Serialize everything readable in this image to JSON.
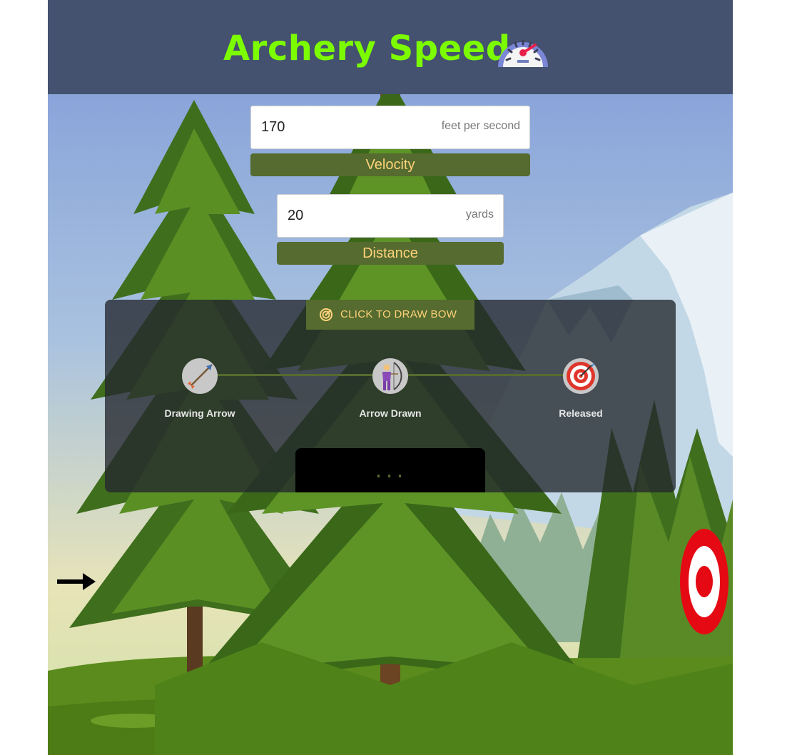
{
  "header": {
    "title": "Archery Speed",
    "icon": "speedometer-icon"
  },
  "velocity": {
    "value": "170",
    "unit": "feet per second",
    "label": "Velocity"
  },
  "distance": {
    "value": "20",
    "unit": "yards",
    "label": "Distance"
  },
  "draw_button": {
    "label": "CLICK TO DRAW BOW",
    "icon": "target-radar-icon"
  },
  "steps": [
    {
      "label": "Drawing Arrow",
      "icon": "arrow-icon"
    },
    {
      "label": "Arrow Drawn",
      "icon": "archer-icon"
    },
    {
      "label": "Released",
      "icon": "bullseye-icon"
    }
  ],
  "status": {
    "text": "..."
  },
  "colors": {
    "header_bg": "#44516f",
    "title": "#7cfc00",
    "accent_olive": "#556b2f",
    "label_text": "#ffd27a",
    "target_red": "#e50914"
  }
}
